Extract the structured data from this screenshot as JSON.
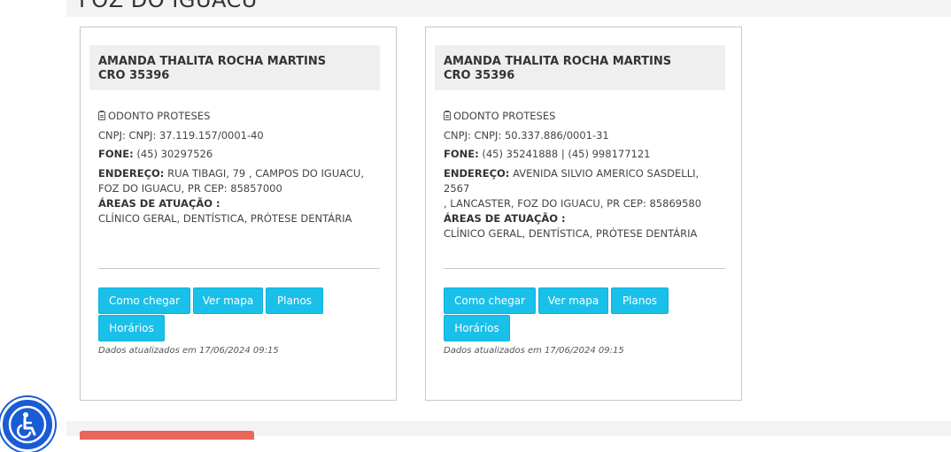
{
  "header": {
    "city": "FOZ DO IGUACU"
  },
  "cards": [
    {
      "name": "AMANDA THALITA ROCHA MARTINS",
      "cro": "CRO 35396",
      "company": "ODONTO PROTESES",
      "cnpj": "CNPJ: CNPJ: 37.119.157/0001-40",
      "fone_label": "FONE:",
      "fone": "(45) 30297526",
      "endereco_label": "ENDEREÇO:",
      "endereco_line1": "RUA TIBAGI, 79 , CAMPOS DO IGUACU,",
      "endereco_line2": "FOZ DO IGUACU, PR CEP: 85857000",
      "areas_label": "ÁREAS DE ATUAÇÃO :",
      "areas": "CLÍNICO GERAL, DENTÍSTICA, PRÓTESE DENTÁRIA",
      "buttons": {
        "como_chegar": "Como chegar",
        "ver_mapa": "Ver mapa",
        "planos": "Planos",
        "horarios": "Horários"
      },
      "updated": "Dados atualizados em 17/06/2024 09:15"
    },
    {
      "name": "AMANDA THALITA ROCHA MARTINS",
      "cro": "CRO 35396",
      "company": "ODONTO PROTESES",
      "cnpj": "CNPJ: CNPJ: 50.337.886/0001-31",
      "fone_label": "FONE:",
      "fone": "(45) 35241888 | (45) 998177121",
      "endereco_label": "ENDEREÇO:",
      "endereco_line1": "AVENIDA SILVIO AMERICO SASDELLI, 2567",
      "endereco_line2": ", LANCASTER, FOZ DO IGUACU, PR CEP: 85869580",
      "areas_label": "ÁREAS DE ATUAÇÃO :",
      "areas": "CLÍNICO GERAL, DENTÍSTICA, PRÓTESE DENTÁRIA",
      "buttons": {
        "como_chegar": "Como chegar",
        "ver_mapa": "Ver mapa",
        "planos": "Planos",
        "horarios": "Horários"
      },
      "updated": "Dados atualizados em 17/06/2024 09:15"
    }
  ],
  "icons": {
    "company": "clipboard-icon",
    "accessibility": "accessibility-icon"
  },
  "colors": {
    "button": "#19c0ea",
    "accessibility": "#1a5bd6",
    "bottom_button": "#e8675a"
  }
}
